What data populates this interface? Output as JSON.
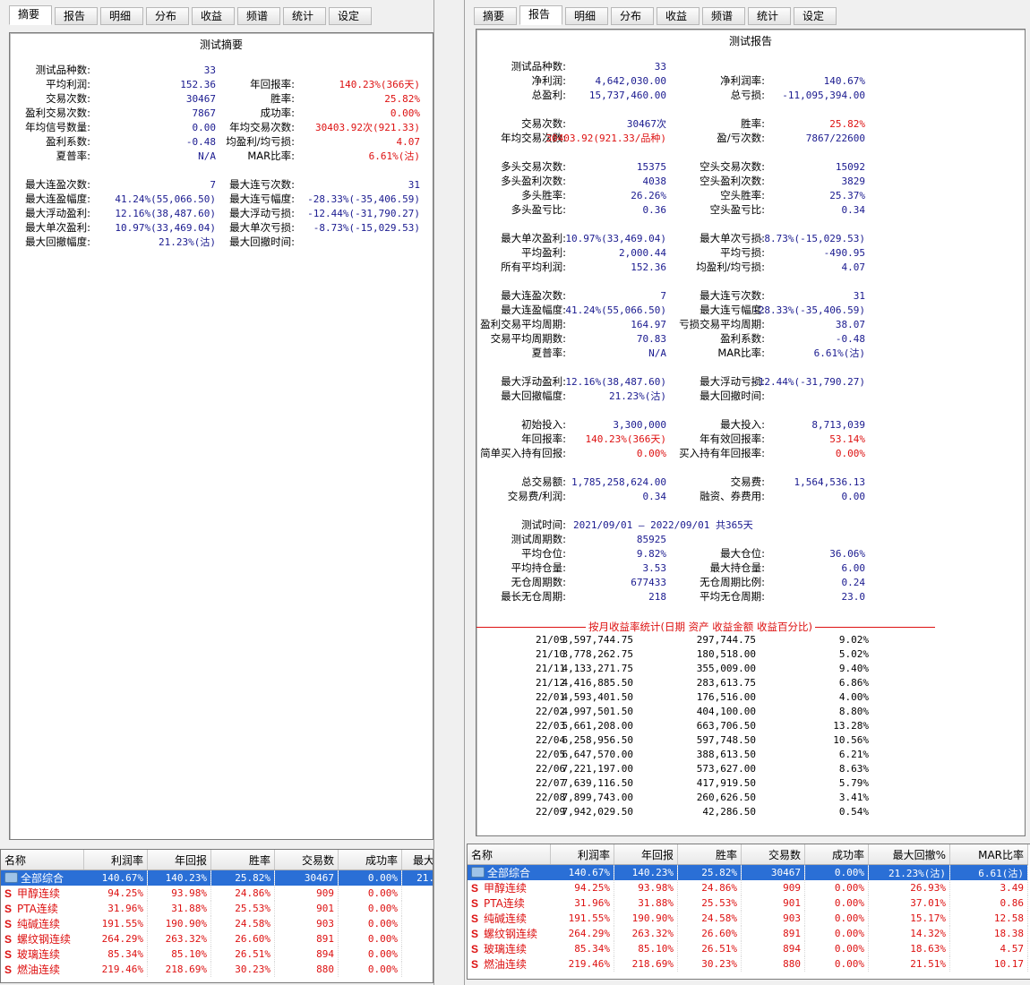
{
  "tabs": [
    "摘要",
    "报告",
    "明细",
    "分布",
    "收益",
    "频谱",
    "统计",
    "设定"
  ],
  "left": {
    "active_tab": 0,
    "title": "测试摘要",
    "rows": [
      {
        "l1": "测试品种数:",
        "v1": "33"
      },
      {
        "l1": "平均利润:",
        "v1": "152.36",
        "l2": "年回报率:",
        "v2": "140.23%(366天)",
        "v2red": true
      },
      {
        "l1": "交易次数:",
        "v1": "30467",
        "l2": "胜率:",
        "v2": "25.82%",
        "v2red": true
      },
      {
        "l1": "盈利交易次数:",
        "v1": "7867",
        "l2": "成功率:",
        "v2": "0.00%",
        "v2red": true
      },
      {
        "l1": "年均信号数量:",
        "v1": "0.00",
        "l2": "年均交易次数:",
        "v2": "30403.92次(921.33)",
        "v2red": true
      },
      {
        "l1": "盈利系数:",
        "v1": "-0.48",
        "l2": "均盈利/均亏损:",
        "v2": "4.07",
        "v2red": true
      },
      {
        "l1": "夏普率:",
        "v1": "N/A",
        "l2": "MAR比率:",
        "v2": "6.61%(沽)",
        "v2red": true
      },
      {
        "blank": true
      },
      {
        "l1": "最大连盈次数:",
        "v1": "7",
        "l2": "最大连亏次数:",
        "v2": "31"
      },
      {
        "l1": "最大连盈幅度:",
        "v1": "41.24%(55,066.50)",
        "l2": "最大连亏幅度:",
        "v2": "-28.33%(-35,406.59)"
      },
      {
        "l1": "最大浮动盈利:",
        "v1": "12.16%(38,487.60)",
        "l2": "最大浮动亏损:",
        "v2": "-12.44%(-31,790.27)"
      },
      {
        "l1": "最大单次盈利:",
        "v1": "10.97%(33,469.04)",
        "l2": "最大单次亏损:",
        "v2": "-8.73%(-15,029.53)"
      },
      {
        "l1": "最大回撤幅度:",
        "v1": "21.23%(沽)",
        "l2": "最大回撤时间:",
        "v2": ""
      }
    ]
  },
  "right": {
    "active_tab": 1,
    "title": "测试报告",
    "rows": [
      {
        "l1": "测试品种数:",
        "v1": "33"
      },
      {
        "l1": "净利润:",
        "v1": "4,642,030.00",
        "l2": "净利润率:",
        "v2": "140.67%"
      },
      {
        "l1": "总盈利:",
        "v1": "15,737,460.00",
        "l2": "总亏损:",
        "v2": "-11,095,394.00"
      },
      {
        "blank": true
      },
      {
        "l1": "交易次数:",
        "v1": "30467次",
        "l2": "胜率:",
        "v2": "25.82%",
        "v2red": true
      },
      {
        "l1": "年均交易次数:",
        "v1": "30403.92(921.33/品种)",
        "v1red": true,
        "l2": "盈/亏次数:",
        "v2": "7867/22600"
      },
      {
        "blank": true
      },
      {
        "l1": "多头交易次数:",
        "v1": "15375",
        "l2": "空头交易次数:",
        "v2": "15092"
      },
      {
        "l1": "多头盈利次数:",
        "v1": "4038",
        "l2": "空头盈利次数:",
        "v2": "3829"
      },
      {
        "l1": "多头胜率:",
        "v1": "26.26%",
        "l2": "空头胜率:",
        "v2": "25.37%"
      },
      {
        "l1": "多头盈亏比:",
        "v1": "0.36",
        "l2": "空头盈亏比:",
        "v2": "0.34"
      },
      {
        "blank": true
      },
      {
        "l1": "最大单次盈利:",
        "v1": "10.97%(33,469.04)",
        "l2": "最大单次亏损:",
        "v2": "-8.73%(-15,029.53)"
      },
      {
        "l1": "平均盈利:",
        "v1": "2,000.44",
        "l2": "平均亏损:",
        "v2": "-490.95"
      },
      {
        "l1": "所有平均利润:",
        "v1": "152.36",
        "l2": "均盈利/均亏损:",
        "v2": "4.07"
      },
      {
        "blank": true
      },
      {
        "l1": "最大连盈次数:",
        "v1": "7",
        "l2": "最大连亏次数:",
        "v2": "31"
      },
      {
        "l1": "最大连盈幅度:",
        "v1": "41.24%(55,066.50)",
        "l2": "最大连亏幅度:",
        "v2": "-28.33%(-35,406.59)"
      },
      {
        "l1": "盈利交易平均周期:",
        "v1": "164.97",
        "l2": "亏损交易平均周期:",
        "v2": "38.07"
      },
      {
        "l1": "交易平均周期数:",
        "v1": "70.83",
        "l2": "盈利系数:",
        "v2": "-0.48"
      },
      {
        "l1": "夏普率:",
        "v1": "N/A",
        "l2": "MAR比率:",
        "v2": "6.61%(沽)"
      },
      {
        "blank": true
      },
      {
        "l1": "最大浮动盈利:",
        "v1": "12.16%(38,487.60)",
        "l2": "最大浮动亏损:",
        "v2": "-12.44%(-31,790.27)"
      },
      {
        "l1": "最大回撤幅度:",
        "v1": "21.23%(沽)",
        "l2": "最大回撤时间:",
        "v2": ""
      },
      {
        "blank": true
      },
      {
        "l1": "初始投入:",
        "v1": "3,300,000",
        "l2": "最大投入:",
        "v2": "8,713,039"
      },
      {
        "l1": "年回报率:",
        "v1": "140.23%(366天)",
        "v1red": true,
        "l2": "年有效回报率:",
        "v2": "53.14%",
        "v2red": true
      },
      {
        "l1": "简单买入持有回报:",
        "v1": "0.00%",
        "v1red": true,
        "l2": "买入持有年回报率:",
        "v2": "0.00%",
        "v2red": true
      },
      {
        "blank": true
      },
      {
        "l1": "总交易额:",
        "v1": "1,785,258,624.00",
        "l2": "交易费:",
        "v2": "1,564,536.13"
      },
      {
        "l1": "交易费/利润:",
        "v1": "0.34",
        "l2": "融资、券费用:",
        "v2": "0.00"
      },
      {
        "blank": true
      },
      {
        "l1": "测试时间:",
        "v1": "2021/09/01 — 2022/09/01  共365天",
        "wide": true
      },
      {
        "l1": "测试周期数:",
        "v1": "85925"
      },
      {
        "l1": "平均仓位:",
        "v1": "9.82%",
        "l2": "最大仓位:",
        "v2": "36.06%"
      },
      {
        "l1": "平均持仓量:",
        "v1": "3.53",
        "l2": "最大持仓量:",
        "v2": "6.00"
      },
      {
        "l1": "无仓周期数:",
        "v1": "677433",
        "l2": "无仓周期比例:",
        "v2": "0.24"
      },
      {
        "l1": "最长无仓周期:",
        "v1": "218",
        "l2": "平均无仓周期:",
        "v2": "23.0"
      }
    ],
    "monthly_title": "按月收益率统计(日期 资产 收益金额 收益百分比)",
    "monthly": [
      [
        "21/09",
        "3,597,744.75",
        "297,744.75",
        "9.02%"
      ],
      [
        "21/10",
        "3,778,262.75",
        "180,518.00",
        "5.02%"
      ],
      [
        "21/11",
        "4,133,271.75",
        "355,009.00",
        "9.40%"
      ],
      [
        "21/12",
        "4,416,885.50",
        "283,613.75",
        "6.86%"
      ],
      [
        "22/01",
        "4,593,401.50",
        "176,516.00",
        "4.00%"
      ],
      [
        "22/02",
        "4,997,501.50",
        "404,100.00",
        "8.80%"
      ],
      [
        "22/03",
        "5,661,208.00",
        "663,706.50",
        "13.28%"
      ],
      [
        "22/04",
        "6,258,956.50",
        "597,748.50",
        "10.56%"
      ],
      [
        "22/05",
        "6,647,570.00",
        "388,613.50",
        "6.21%"
      ],
      [
        "22/06",
        "7,221,197.00",
        "573,627.00",
        "8.63%"
      ],
      [
        "22/07",
        "7,639,116.50",
        "417,919.50",
        "5.79%"
      ],
      [
        "22/08",
        "7,899,743.00",
        "260,626.50",
        "3.41%"
      ],
      [
        "22/09",
        "7,942,029.50",
        "42,286.50",
        "0.54%"
      ]
    ]
  },
  "grid_left": {
    "headers": [
      "名称",
      "利润率",
      "年回报",
      "胜率",
      "交易数",
      "成功率",
      "最大"
    ],
    "rows": [
      [
        "全部综合",
        "140.67%",
        "140.23%",
        "25.82%",
        "30467",
        "0.00%",
        "21."
      ],
      [
        "甲醇连续",
        "94.25%",
        "93.98%",
        "24.86%",
        "909",
        "0.00%",
        ""
      ],
      [
        "PTA连续",
        "31.96%",
        "31.88%",
        "25.53%",
        "901",
        "0.00%",
        ""
      ],
      [
        "纯碱连续",
        "191.55%",
        "190.90%",
        "24.58%",
        "903",
        "0.00%",
        ""
      ],
      [
        "螺纹钢连续",
        "264.29%",
        "263.32%",
        "26.60%",
        "891",
        "0.00%",
        ""
      ],
      [
        "玻璃连续",
        "85.34%",
        "85.10%",
        "26.51%",
        "894",
        "0.00%",
        ""
      ],
      [
        "燃油连续",
        "219.46%",
        "218.69%",
        "30.23%",
        "880",
        "0.00%",
        ""
      ]
    ]
  },
  "grid_right": {
    "headers": [
      "名称",
      "利润率",
      "年回报",
      "胜率",
      "交易数",
      "成功率",
      "最大回撤%",
      "MAR比率"
    ],
    "rows": [
      [
        "全部综合",
        "140.67%",
        "140.23%",
        "25.82%",
        "30467",
        "0.00%",
        "21.23%(沽)",
        "6.61(沽)"
      ],
      [
        "甲醇连续",
        "94.25%",
        "93.98%",
        "24.86%",
        "909",
        "0.00%",
        "26.93%",
        "3.49"
      ],
      [
        "PTA连续",
        "31.96%",
        "31.88%",
        "25.53%",
        "901",
        "0.00%",
        "37.01%",
        "0.86"
      ],
      [
        "纯碱连续",
        "191.55%",
        "190.90%",
        "24.58%",
        "903",
        "0.00%",
        "15.17%",
        "12.58"
      ],
      [
        "螺纹钢连续",
        "264.29%",
        "263.32%",
        "26.60%",
        "891",
        "0.00%",
        "14.32%",
        "18.38"
      ],
      [
        "玻璃连续",
        "85.34%",
        "85.10%",
        "26.51%",
        "894",
        "0.00%",
        "18.63%",
        "4.57"
      ],
      [
        "燃油连续",
        "219.46%",
        "218.69%",
        "30.23%",
        "880",
        "0.00%",
        "21.51%",
        "10.17"
      ]
    ],
    "s_marker": "S"
  }
}
